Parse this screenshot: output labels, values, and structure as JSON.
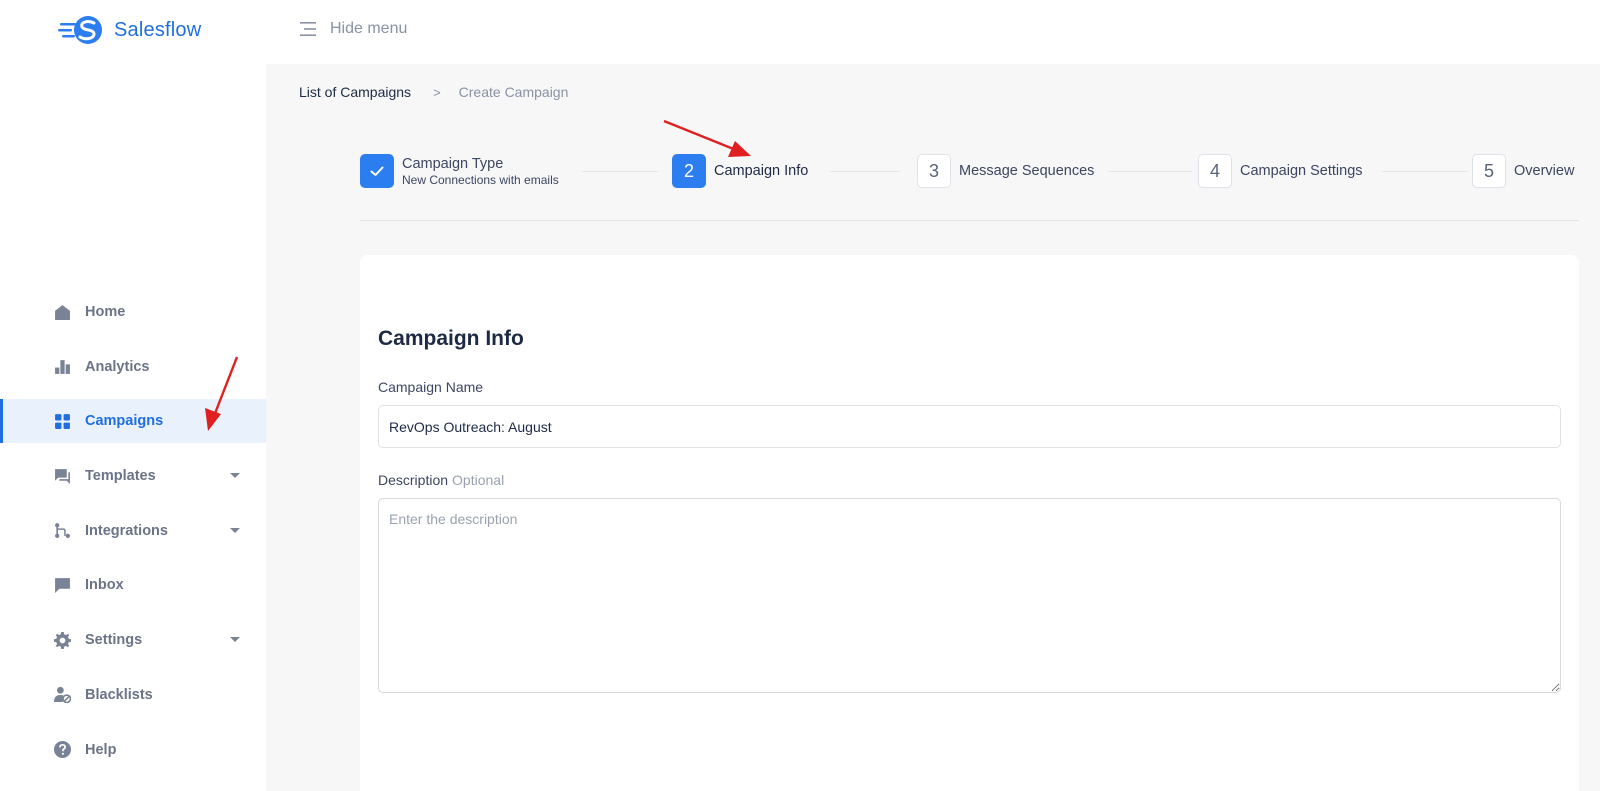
{
  "app": {
    "brand": "Salesflow",
    "brand_color": "#1f6fe0"
  },
  "topbar": {
    "hide_menu_label": "Hide menu",
    "icon": "menu-icon"
  },
  "sidebar": {
    "items": [
      {
        "label": "Home",
        "icon": "home-icon",
        "active": false,
        "has_caret": false
      },
      {
        "label": "Analytics",
        "icon": "bar-chart-icon",
        "active": false,
        "has_caret": false
      },
      {
        "label": "Campaigns",
        "icon": "grid-icon",
        "active": true,
        "has_caret": false
      },
      {
        "label": "Templates",
        "icon": "chat-icon",
        "active": false,
        "has_caret": true
      },
      {
        "label": "Integrations",
        "icon": "branch-icon",
        "active": false,
        "has_caret": true
      },
      {
        "label": "Inbox",
        "icon": "message-icon",
        "active": false,
        "has_caret": false
      },
      {
        "label": "Settings",
        "icon": "gear-icon",
        "active": false,
        "has_caret": true
      },
      {
        "label": "Blacklists",
        "icon": "user-blocked-icon",
        "active": false,
        "has_caret": false
      },
      {
        "label": "Help",
        "icon": "help-icon",
        "active": false,
        "has_caret": false
      }
    ]
  },
  "breadcrumb": {
    "parent": "List of Campaigns",
    "separator": ">",
    "current": "Create Campaign"
  },
  "stepper": {
    "steps": [
      {
        "number": "",
        "title": "Campaign Type",
        "subtitle": "New Connections with emails",
        "state": "done"
      },
      {
        "number": "2",
        "title": "Campaign Info",
        "subtitle": "",
        "state": "current"
      },
      {
        "number": "3",
        "title": "Message Sequences",
        "subtitle": "",
        "state": "pending"
      },
      {
        "number": "4",
        "title": "Campaign Settings",
        "subtitle": "",
        "state": "pending"
      },
      {
        "number": "5",
        "title": "Overview",
        "subtitle": "",
        "state": "pending"
      }
    ]
  },
  "form": {
    "title": "Campaign Info",
    "name_label": "Campaign Name",
    "name_value": "RevOps Outreach: August",
    "description_label": "Description",
    "description_optional": "Optional",
    "description_placeholder": "Enter the description",
    "description_value": ""
  },
  "colors": {
    "accent": "#2b7df0",
    "annotation_arrow": "#e02020"
  }
}
